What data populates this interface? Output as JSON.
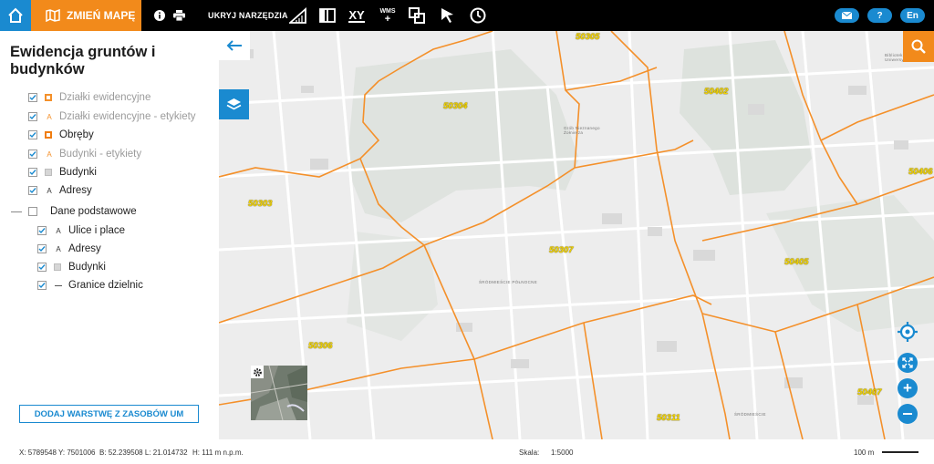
{
  "topbar": {
    "map_button": "ZMIEŃ MAPĘ",
    "hide_tools": "UKRYJ NARZĘDZIA",
    "xy_label": "XY",
    "wms_label": "WMS",
    "help_label": "?",
    "lang_label": "En",
    "icons": [
      "home-icon",
      "map-icon",
      "info-icon",
      "printer-icon",
      "measure-icon",
      "compare-icon",
      "coordinates-icon",
      "wms-add-icon",
      "overlap-icon",
      "cursor-icon",
      "history-clock-icon",
      "mail-icon"
    ]
  },
  "panel": {
    "title": "Ewidencja gruntów i budynków",
    "layers": [
      {
        "label": "Działki ewidencyjne",
        "checked": true,
        "symbol": "square-orange",
        "style": "gray"
      },
      {
        "label": "Działki ewidencyjne - etykiety",
        "checked": true,
        "symbol": "A-orange",
        "style": "gray"
      },
      {
        "label": "Obręby",
        "checked": true,
        "symbol": "square-orange-bold",
        "style": "dark"
      },
      {
        "label": "Budynki - etykiety",
        "checked": true,
        "symbol": "A-orange",
        "style": "gray"
      },
      {
        "label": "Budynki",
        "checked": true,
        "symbol": "square-gray",
        "style": "dark"
      },
      {
        "label": "Adresy",
        "checked": true,
        "symbol": "A-dark",
        "style": "dark"
      }
    ],
    "group": {
      "label": "Dane podstawowe",
      "checked": false,
      "items": [
        {
          "label": "Ulice i place",
          "checked": true,
          "symbol": "A-dark"
        },
        {
          "label": "Adresy",
          "checked": true,
          "symbol": "A-dark"
        },
        {
          "label": "Budynki",
          "checked": true,
          "symbol": "square-gray"
        },
        {
          "label": "Granice dzielnic",
          "checked": true,
          "symbol": "line-gray"
        }
      ]
    },
    "add_layer_button": "DODAJ WARSTWĘ Z ZASOBÓW UM"
  },
  "map": {
    "region_labels": [
      "50305",
      "50304",
      "50402",
      "50406",
      "50303",
      "50307",
      "50405",
      "50306",
      "50311",
      "50407"
    ],
    "place_labels": {
      "grob": "Grób Nieznanego Żołnierza",
      "srodmiescie_pn": "ŚRÓDMIEŚCIE PÓŁNOCNE",
      "srodmiescie": "ŚRÓDMIEŚCIE",
      "biblioteka": "Biblioteka Uniwersytecka"
    },
    "colors": {
      "boundary": "#f4902a",
      "accent": "#1a8ad0",
      "orange_btn": "#f28a1b",
      "label_yellow": "#f3d400"
    }
  },
  "status": {
    "xy": "X: 5789548 Y: 7501006",
    "bl": "B: 52.239508 L: 21.014732",
    "h": "H: 111 m n.p.m.",
    "scale_label": "Skala:",
    "scale_value": "1:5000",
    "scalebar_label": "100 m"
  }
}
